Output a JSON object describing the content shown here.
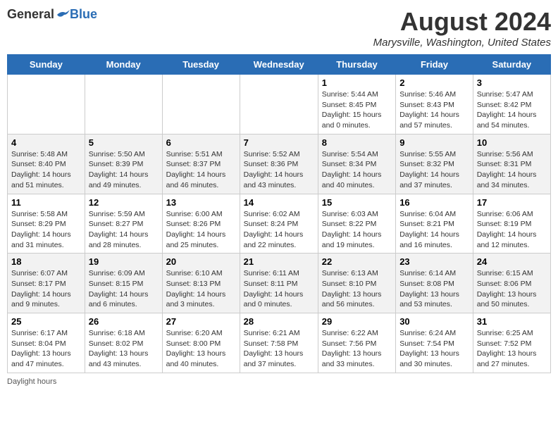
{
  "header": {
    "logo_general": "General",
    "logo_blue": "Blue",
    "month_title": "August 2024",
    "location": "Marysville, Washington, United States"
  },
  "days_of_week": [
    "Sunday",
    "Monday",
    "Tuesday",
    "Wednesday",
    "Thursday",
    "Friday",
    "Saturday"
  ],
  "weeks": [
    [
      {
        "day": "",
        "info": ""
      },
      {
        "day": "",
        "info": ""
      },
      {
        "day": "",
        "info": ""
      },
      {
        "day": "",
        "info": ""
      },
      {
        "day": "1",
        "info": "Sunrise: 5:44 AM\nSunset: 8:45 PM\nDaylight: 15 hours\nand 0 minutes."
      },
      {
        "day": "2",
        "info": "Sunrise: 5:46 AM\nSunset: 8:43 PM\nDaylight: 14 hours\nand 57 minutes."
      },
      {
        "day": "3",
        "info": "Sunrise: 5:47 AM\nSunset: 8:42 PM\nDaylight: 14 hours\nand 54 minutes."
      }
    ],
    [
      {
        "day": "4",
        "info": "Sunrise: 5:48 AM\nSunset: 8:40 PM\nDaylight: 14 hours\nand 51 minutes."
      },
      {
        "day": "5",
        "info": "Sunrise: 5:50 AM\nSunset: 8:39 PM\nDaylight: 14 hours\nand 49 minutes."
      },
      {
        "day": "6",
        "info": "Sunrise: 5:51 AM\nSunset: 8:37 PM\nDaylight: 14 hours\nand 46 minutes."
      },
      {
        "day": "7",
        "info": "Sunrise: 5:52 AM\nSunset: 8:36 PM\nDaylight: 14 hours\nand 43 minutes."
      },
      {
        "day": "8",
        "info": "Sunrise: 5:54 AM\nSunset: 8:34 PM\nDaylight: 14 hours\nand 40 minutes."
      },
      {
        "day": "9",
        "info": "Sunrise: 5:55 AM\nSunset: 8:32 PM\nDaylight: 14 hours\nand 37 minutes."
      },
      {
        "day": "10",
        "info": "Sunrise: 5:56 AM\nSunset: 8:31 PM\nDaylight: 14 hours\nand 34 minutes."
      }
    ],
    [
      {
        "day": "11",
        "info": "Sunrise: 5:58 AM\nSunset: 8:29 PM\nDaylight: 14 hours\nand 31 minutes."
      },
      {
        "day": "12",
        "info": "Sunrise: 5:59 AM\nSunset: 8:27 PM\nDaylight: 14 hours\nand 28 minutes."
      },
      {
        "day": "13",
        "info": "Sunrise: 6:00 AM\nSunset: 8:26 PM\nDaylight: 14 hours\nand 25 minutes."
      },
      {
        "day": "14",
        "info": "Sunrise: 6:02 AM\nSunset: 8:24 PM\nDaylight: 14 hours\nand 22 minutes."
      },
      {
        "day": "15",
        "info": "Sunrise: 6:03 AM\nSunset: 8:22 PM\nDaylight: 14 hours\nand 19 minutes."
      },
      {
        "day": "16",
        "info": "Sunrise: 6:04 AM\nSunset: 8:21 PM\nDaylight: 14 hours\nand 16 minutes."
      },
      {
        "day": "17",
        "info": "Sunrise: 6:06 AM\nSunset: 8:19 PM\nDaylight: 14 hours\nand 12 minutes."
      }
    ],
    [
      {
        "day": "18",
        "info": "Sunrise: 6:07 AM\nSunset: 8:17 PM\nDaylight: 14 hours\nand 9 minutes."
      },
      {
        "day": "19",
        "info": "Sunrise: 6:09 AM\nSunset: 8:15 PM\nDaylight: 14 hours\nand 6 minutes."
      },
      {
        "day": "20",
        "info": "Sunrise: 6:10 AM\nSunset: 8:13 PM\nDaylight: 14 hours\nand 3 minutes."
      },
      {
        "day": "21",
        "info": "Sunrise: 6:11 AM\nSunset: 8:11 PM\nDaylight: 14 hours\nand 0 minutes."
      },
      {
        "day": "22",
        "info": "Sunrise: 6:13 AM\nSunset: 8:10 PM\nDaylight: 13 hours\nand 56 minutes."
      },
      {
        "day": "23",
        "info": "Sunrise: 6:14 AM\nSunset: 8:08 PM\nDaylight: 13 hours\nand 53 minutes."
      },
      {
        "day": "24",
        "info": "Sunrise: 6:15 AM\nSunset: 8:06 PM\nDaylight: 13 hours\nand 50 minutes."
      }
    ],
    [
      {
        "day": "25",
        "info": "Sunrise: 6:17 AM\nSunset: 8:04 PM\nDaylight: 13 hours\nand 47 minutes."
      },
      {
        "day": "26",
        "info": "Sunrise: 6:18 AM\nSunset: 8:02 PM\nDaylight: 13 hours\nand 43 minutes."
      },
      {
        "day": "27",
        "info": "Sunrise: 6:20 AM\nSunset: 8:00 PM\nDaylight: 13 hours\nand 40 minutes."
      },
      {
        "day": "28",
        "info": "Sunrise: 6:21 AM\nSunset: 7:58 PM\nDaylight: 13 hours\nand 37 minutes."
      },
      {
        "day": "29",
        "info": "Sunrise: 6:22 AM\nSunset: 7:56 PM\nDaylight: 13 hours\nand 33 minutes."
      },
      {
        "day": "30",
        "info": "Sunrise: 6:24 AM\nSunset: 7:54 PM\nDaylight: 13 hours\nand 30 minutes."
      },
      {
        "day": "31",
        "info": "Sunrise: 6:25 AM\nSunset: 7:52 PM\nDaylight: 13 hours\nand 27 minutes."
      }
    ]
  ],
  "footer": {
    "daylight_label": "Daylight hours"
  }
}
